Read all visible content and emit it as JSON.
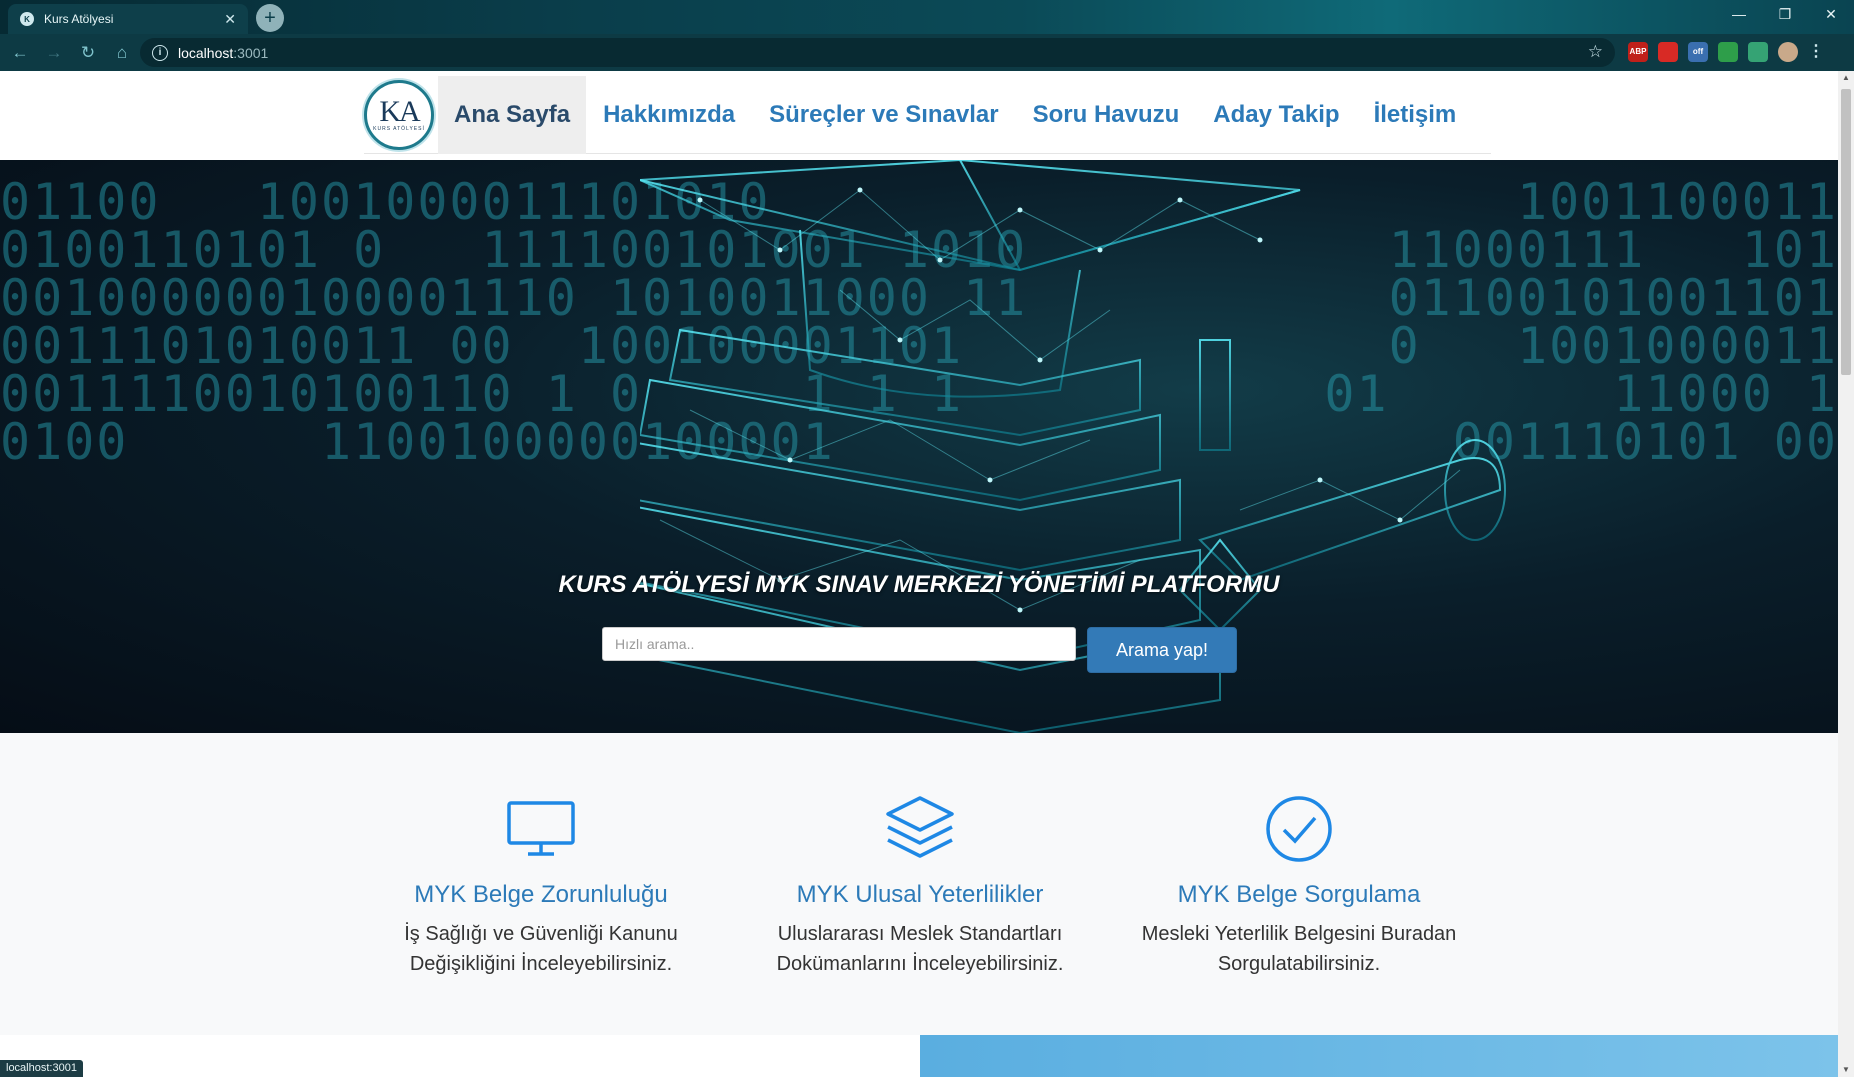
{
  "browser": {
    "tab_title": "Kurs Atölyesi",
    "url_host": "localhost",
    "url_port": ":3001",
    "status_text": "localhost:3001",
    "extensions": [
      {
        "name": "abp",
        "label": "ABP",
        "color": "#c0201a"
      },
      {
        "name": "red-ext",
        "label": "",
        "color": "#d82a25"
      },
      {
        "name": "off-ext",
        "label": "off",
        "color": "#3a6fb0"
      },
      {
        "name": "green-ext",
        "label": "",
        "color": "#2e9e4a"
      },
      {
        "name": "puzzle",
        "label": "",
        "color": "#35a374"
      }
    ]
  },
  "site_nav": {
    "logo_mark": "KA",
    "logo_sub": "KURS ATÖLYESİ",
    "items": [
      {
        "label": "Ana Sayfa",
        "active": true
      },
      {
        "label": "Hakkımızda",
        "active": false
      },
      {
        "label": "Süreçler ve Sınavlar",
        "active": false
      },
      {
        "label": "Soru Havuzu",
        "active": false
      },
      {
        "label": "Aday Takip",
        "active": false
      },
      {
        "label": "İletişim",
        "active": false
      }
    ]
  },
  "hero": {
    "binary_lines": [
      "01100   1001000011101010",
      "0100110101 0   111100101001 1010",
      "001000000100001110 1010011000 11",
      "0011101010011 00  100100001101",
      "0011110010100110 1 0     1 1 1",
      "0100      1100100000100001"
    ],
    "binary_right": [
      "1001100011",
      "11000111   101",
      "01100101001101",
      "0   1001000011",
      "01       11000 1",
      "001110101 00"
    ],
    "title": "KURS ATÖLYESİ MYK SINAV MERKEZİ YÖNETİMİ PLATFORMU",
    "search_placeholder": "Hızlı arama..",
    "search_button": "Arama yap!"
  },
  "features": [
    {
      "icon": "monitor-icon",
      "title": "MYK Belge Zorunluluğu",
      "desc": "İş Sağlığı ve Güvenliği Kanunu Değişikliğini İnceleyebilirsiniz."
    },
    {
      "icon": "layers-icon",
      "title": "MYK Ulusal Yeterlilikler",
      "desc": "Uluslararası Meslek Standartları Dokümanlarını İnceleyebilirsiniz."
    },
    {
      "icon": "check-circle-icon",
      "title": "MYK Belge Sorgulama",
      "desc": "Mesleki Yeterlilik Belgesini Buradan Sorgulatabilirsiniz."
    }
  ],
  "colors": {
    "accent_blue": "#2c7ab8",
    "icon_blue": "#1e88e5",
    "button_blue": "#337ab7"
  }
}
